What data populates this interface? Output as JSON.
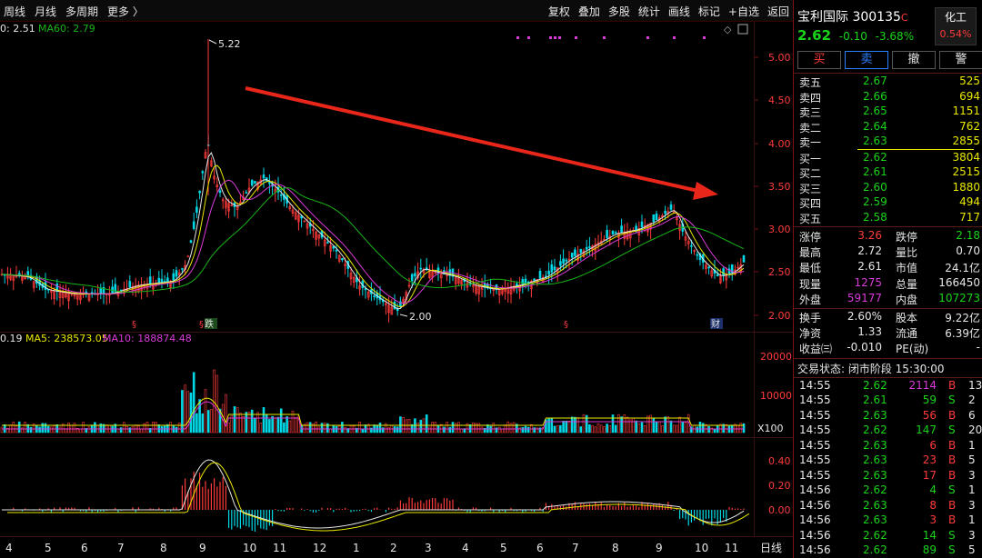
{
  "topbar": {
    "tabs": [
      "周线",
      "月线",
      "多周期",
      "更多 〉"
    ],
    "tools": [
      "复权",
      "叠加",
      "多股",
      "统计",
      "画线",
      "标记",
      "+自选",
      "返回"
    ]
  },
  "price_legend": {
    "ma_partial": "0: 2.51",
    "ma60": "MA60: 2.79"
  },
  "volume_legend": {
    "vol": "0.19",
    "ma5": "MA5: 238573.05",
    "ma10": "MA10: 188874.48"
  },
  "annotations": {
    "high": "5.22",
    "low": "2.00",
    "marker_s": "§",
    "marker_die": "跌",
    "marker_cai": "财"
  },
  "price_axis": [
    "5.00",
    "4.50",
    "4.00",
    "3.50",
    "3.00",
    "2.50",
    "2.00"
  ],
  "volume_axis": [
    "20000",
    "10000"
  ],
  "volume_unit": "X100",
  "macd_axis": [
    "0.40",
    "0.20",
    "0.00"
  ],
  "month_labels": [
    "4",
    "5",
    "6",
    "7",
    "8",
    "9",
    "10",
    "11",
    "12",
    "1",
    "2",
    "3",
    "4",
    "5",
    "6",
    "7",
    "8",
    "9",
    "10",
    "11"
  ],
  "period_label": "日线",
  "colors": {
    "up": "#ff3b3b",
    "down": "#00d8e6",
    "ma_white": "#e6e6e6",
    "ma_yellow": "#e8e800",
    "ma_magenta": "#d93bd9",
    "ma_green": "#19b419"
  },
  "stock": {
    "name": "宝利国际",
    "code": "300135",
    "badge": "C",
    "price": "2.62",
    "change": "-0.10",
    "pct": "-3.68%",
    "sector": "化工",
    "sector_pct": "0.54%"
  },
  "actions": [
    "买",
    "卖",
    "撤",
    "警"
  ],
  "asks": [
    {
      "label": "卖五",
      "price": "2.67",
      "vol": "525"
    },
    {
      "label": "卖四",
      "price": "2.66",
      "vol": "694"
    },
    {
      "label": "卖三",
      "price": "2.65",
      "vol": "1151"
    },
    {
      "label": "卖二",
      "price": "2.64",
      "vol": "762"
    },
    {
      "label": "卖一",
      "price": "2.63",
      "vol": "2855"
    }
  ],
  "bids": [
    {
      "label": "买一",
      "price": "2.62",
      "vol": "3804"
    },
    {
      "label": "买二",
      "price": "2.61",
      "vol": "2515"
    },
    {
      "label": "买三",
      "price": "2.60",
      "vol": "1880"
    },
    {
      "label": "买四",
      "price": "2.59",
      "vol": "494"
    },
    {
      "label": "买五",
      "price": "2.58",
      "vol": "717"
    }
  ],
  "stats": [
    {
      "l1": "涨停",
      "v1": "3.26",
      "l2": "跌停",
      "v2": "2.18"
    },
    {
      "l1": "最高",
      "v1": "2.72",
      "l2": "量比",
      "v2": "0.70"
    },
    {
      "l1": "最低",
      "v1": "2.61",
      "l2": "市值",
      "v2": "24.1亿"
    },
    {
      "l1": "现量",
      "v1": "1275",
      "l2": "总量",
      "v2": "166450"
    },
    {
      "l1": "外盘",
      "v1": "59177",
      "l2": "内盘",
      "v2": "107273"
    }
  ],
  "stats2": [
    {
      "l1": "换手",
      "v1": "2.60%",
      "l2": "股本",
      "v2": "9.22亿"
    },
    {
      "l1": "净资",
      "v1": "1.33",
      "l2": "流通",
      "v2": "6.39亿"
    },
    {
      "l1": "收益㈢",
      "v1": "-0.010",
      "l2": "PE(动)",
      "v2": "-"
    }
  ],
  "trade_status": "交易状态: 闭市阶段 15:30:00",
  "ticks": [
    {
      "t": "14:55",
      "p": "2.62",
      "v": "2114",
      "s": "B",
      "n": "13"
    },
    {
      "t": "14:55",
      "p": "2.61",
      "v": "59",
      "s": "S",
      "n": "2"
    },
    {
      "t": "14:55",
      "p": "2.63",
      "v": "56",
      "s": "B",
      "n": "6"
    },
    {
      "t": "14:55",
      "p": "2.62",
      "v": "147",
      "s": "S",
      "n": "20"
    },
    {
      "t": "14:55",
      "p": "2.63",
      "v": "6",
      "s": "B",
      "n": "1"
    },
    {
      "t": "14:55",
      "p": "2.63",
      "v": "23",
      "s": "B",
      "n": "5"
    },
    {
      "t": "14:55",
      "p": "2.63",
      "v": "17",
      "s": "B",
      "n": "3"
    },
    {
      "t": "14:56",
      "p": "2.62",
      "v": "4",
      "s": "S",
      "n": "1"
    },
    {
      "t": "14:56",
      "p": "2.63",
      "v": "8",
      "s": "B",
      "n": "3"
    },
    {
      "t": "14:56",
      "p": "2.63",
      "v": "3",
      "s": "B",
      "n": "1"
    },
    {
      "t": "14:56",
      "p": "2.62",
      "v": "14",
      "s": "S",
      "n": "3"
    },
    {
      "t": "14:56",
      "p": "2.62",
      "v": "89",
      "s": "S",
      "n": "5"
    }
  ]
}
